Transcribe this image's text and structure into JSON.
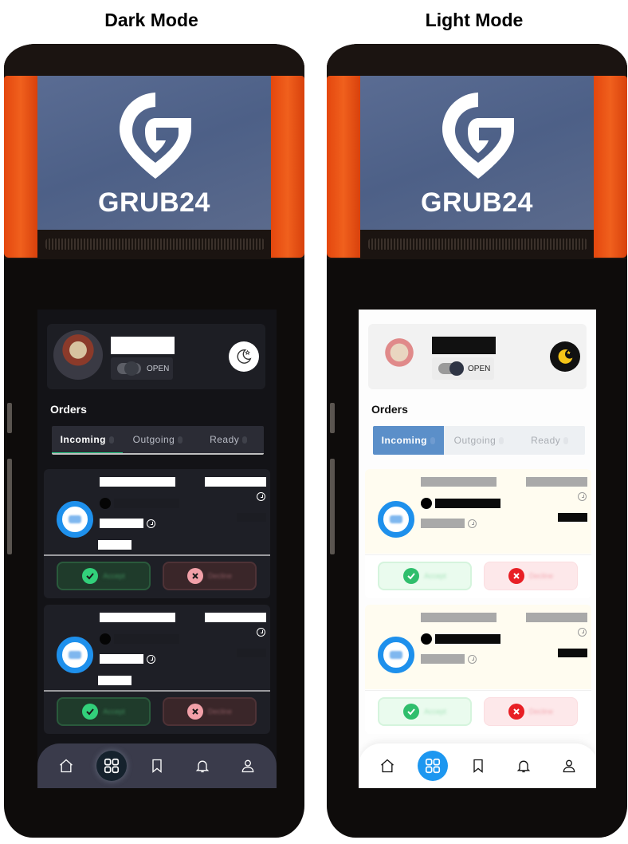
{
  "titles": {
    "dark": "Dark Mode",
    "light": "Light Mode"
  },
  "brand": {
    "name": "GRUB24",
    "logo_icon": "grub24-g-pin-logo",
    "colors": {
      "orange": "#e94f12",
      "panel_blue": "#52648b",
      "accent_blue": "#1e90ec",
      "green": "#27c383"
    }
  },
  "screens": [
    {
      "mode": "dark",
      "store_status": {
        "label": "OPEN",
        "toggle_on": true
      },
      "theme_toggle_icon": "moon-stars-icon",
      "section_title": "Orders",
      "tabs": [
        {
          "label": "Incoming",
          "active": true
        },
        {
          "label": "Outgoing",
          "active": false
        },
        {
          "label": "Ready",
          "active": false
        }
      ],
      "orders": [
        {
          "accept_label": "Accept",
          "decline_label": "Decline"
        },
        {
          "accept_label": "Accept",
          "decline_label": "Decline"
        }
      ],
      "nav": [
        "home-icon",
        "grid-icon",
        "bookmark-icon",
        "bell-icon",
        "user-icon"
      ],
      "nav_active": 1
    },
    {
      "mode": "light",
      "store_status": {
        "label": "OPEN",
        "toggle_on": true
      },
      "theme_toggle_icon": "moon-stars-icon",
      "section_title": "Orders",
      "tabs": [
        {
          "label": "Incoming",
          "active": true
        },
        {
          "label": "Outgoing",
          "active": false
        },
        {
          "label": "Ready",
          "active": false
        }
      ],
      "orders": [
        {
          "accept_label": "Accept",
          "decline_label": "Decline"
        },
        {
          "accept_label": "Accept",
          "decline_label": "Decline"
        }
      ],
      "nav": [
        "home-icon",
        "grid-icon",
        "bookmark-icon",
        "bell-icon",
        "user-icon"
      ],
      "nav_active": 1
    }
  ]
}
